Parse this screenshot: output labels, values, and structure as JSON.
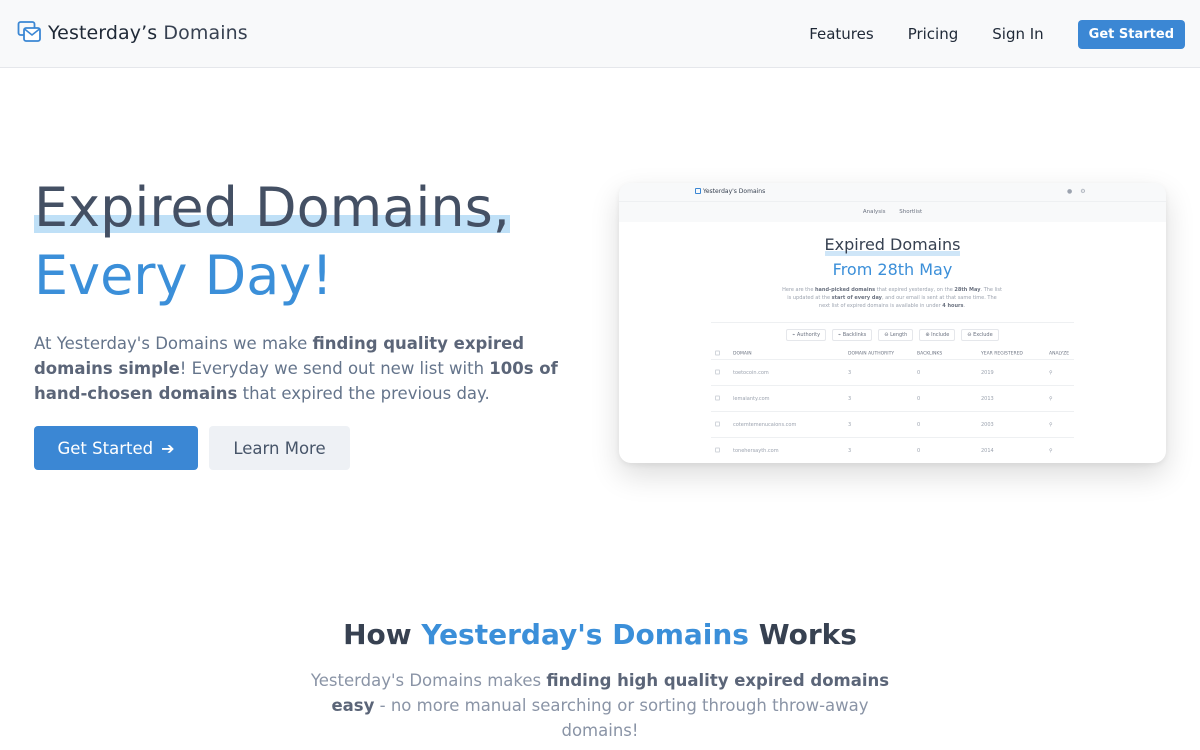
{
  "nav": {
    "logo_brand": "Yesterday’s",
    "logo_suffix": "Domains",
    "links": [
      "Features",
      "Pricing",
      "Sign In"
    ],
    "cta": "Get Started"
  },
  "hero": {
    "title_line1": "Expired Domains,",
    "title_line2": "Every Day!",
    "desc_parts": [
      "At Yesterday's Domains we make ",
      "finding quality expired domains simple",
      "! Everyday we send out new list with ",
      "100s of hand-chosen domains",
      " that expired the previous day."
    ],
    "primary_button": "Get Started",
    "secondary_button": "Learn More"
  },
  "preview": {
    "logo": "Yesterday's Domains",
    "tabs": [
      "Analysis",
      "Shortlist"
    ],
    "title": "Expired Domains",
    "subtitle": "From 28th May",
    "desc_parts": [
      "Here are the ",
      "hand-picked domains",
      " that expired yesterday, on the ",
      "28th May",
      ". The list is updated at the ",
      "start of every day",
      ", and our email is sent at that same time. The next list of expired domains is available in under ",
      "4 hours",
      "."
    ],
    "filters": [
      "Authority",
      "Backlinks",
      "Length",
      "Include",
      "Exclude"
    ],
    "columns": [
      "DOMAIN",
      "DOMAIN AUTHORITY",
      "BACKLINKS",
      "YEAR REGISTERED",
      "ANALYZE"
    ],
    "rows": [
      {
        "domain": "toetocoin.com",
        "authority": "3",
        "backlinks": "0",
        "year": "2019"
      },
      {
        "domain": "lemaianty.com",
        "authority": "3",
        "backlinks": "0",
        "year": "2013"
      },
      {
        "domain": "cotemtemenucaions.com",
        "authority": "3",
        "backlinks": "0",
        "year": "2003"
      },
      {
        "domain": "tonehersayth.com",
        "authority": "3",
        "backlinks": "0",
        "year": "2014"
      }
    ]
  },
  "how": {
    "title_pre": "How ",
    "title_accent": "Yesterday's Domains",
    "title_post": " Works",
    "desc_parts": [
      "Yesterday's Domains makes ",
      "finding high quality expired domains easy",
      " - no more manual searching or sorting through throw-away domains!"
    ]
  },
  "colors": {
    "accent": "#3b87d4",
    "highlight": "#bfe0f7",
    "heading": "#445064"
  }
}
